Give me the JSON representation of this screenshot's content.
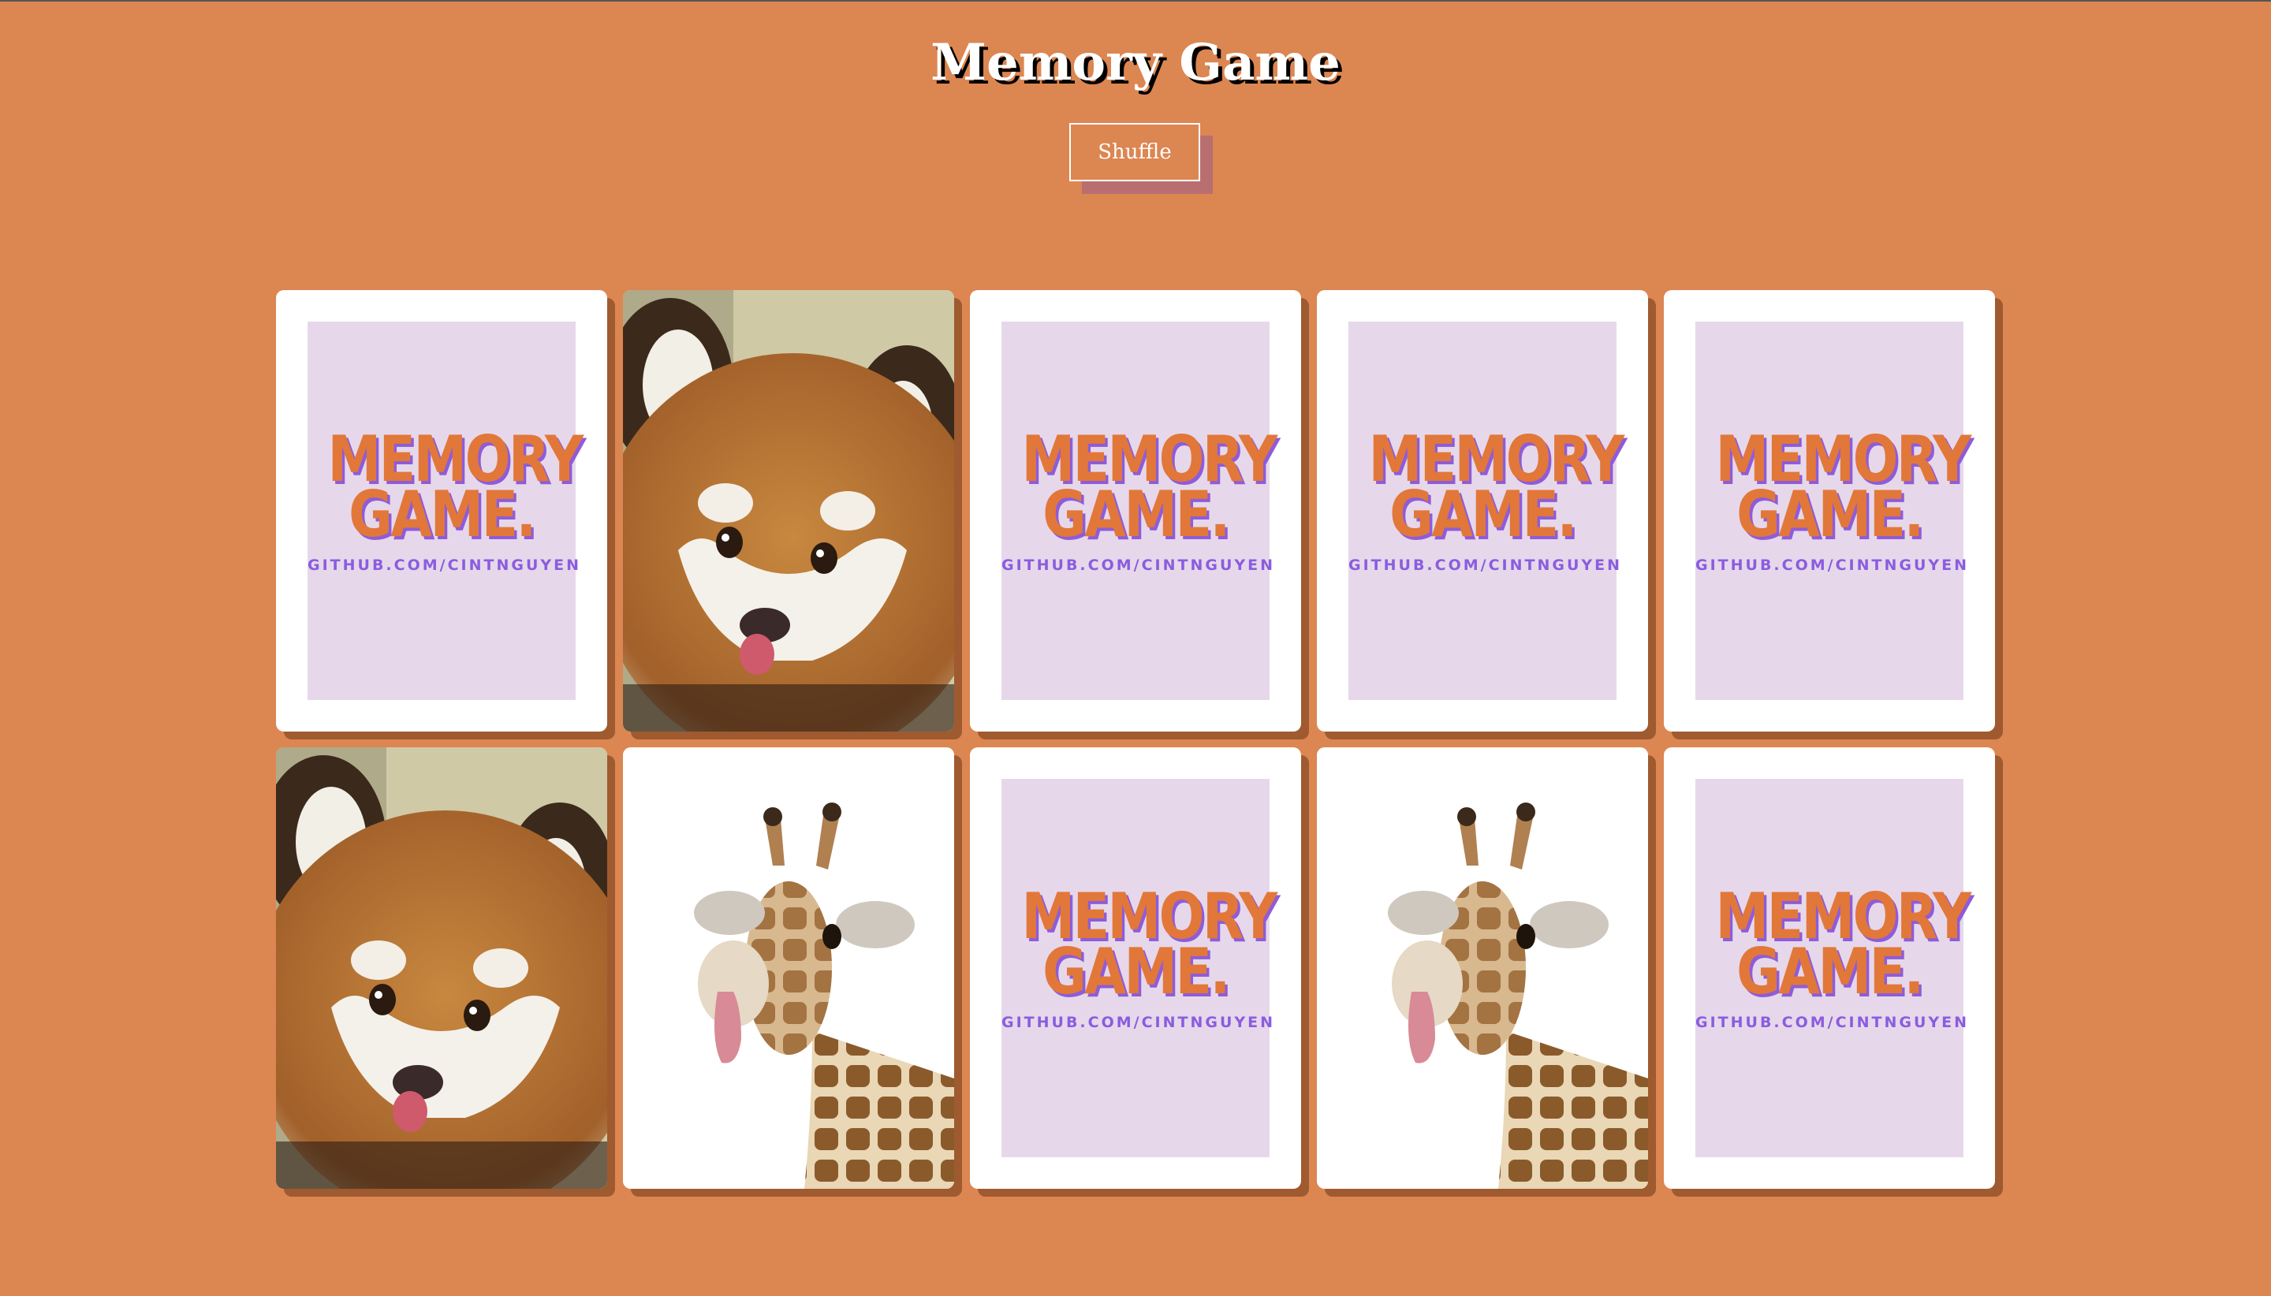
{
  "header": {
    "title": "Memory Game",
    "shuffle_label": "Shuffle"
  },
  "card_back": {
    "logo_line1": "MEMORY",
    "logo_line2": "GAME.",
    "logo_sub": "GITHUB.COM/CINTNGUYEN"
  },
  "cards": [
    {
      "state": "face-down"
    },
    {
      "state": "face-up",
      "animal": "red-panda"
    },
    {
      "state": "face-down"
    },
    {
      "state": "face-down"
    },
    {
      "state": "face-down"
    },
    {
      "state": "face-up",
      "animal": "red-panda"
    },
    {
      "state": "face-up",
      "animal": "giraffe"
    },
    {
      "state": "face-down"
    },
    {
      "state": "face-up",
      "animal": "giraffe"
    },
    {
      "state": "face-down"
    }
  ],
  "colors": {
    "background": "#DC8652",
    "card_back": "#E6D8EA",
    "logo_orange": "#E2773A",
    "logo_purple": "#8B5CE0"
  }
}
